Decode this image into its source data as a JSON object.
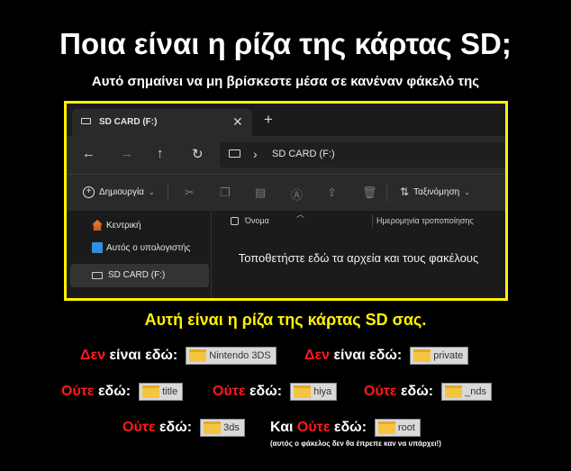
{
  "title": "Ποια είναι η ρίζα της κάρτας SD;",
  "subtitle": "Αυτό σημαίνει να μη βρίσκεστε μέσα σε κανέναν φάκελό της",
  "explorer": {
    "tab_label": "SD CARD (F:)",
    "tab_close": "✕",
    "new_tab": "+",
    "address_path": "SD CARD (F:)",
    "new_label": "Δημιουργία",
    "sort_label": "Ταξινόμηση",
    "sidebar": {
      "home": "Κεντρική",
      "this_pc": "Αυτός ο υπολογιστής",
      "sd_card": "SD CARD (F:)"
    },
    "columns": {
      "name": "Όνομα",
      "date": "Ημερομηνία τροποποίησης"
    },
    "placeholder": "Τοποθετήστε εδώ τα αρχεία και τους φακέλους"
  },
  "root_line": "Αυτή είναι η ρίζα της κάρτας SD σας.",
  "labels": {
    "den": "Δεν",
    "einai_edo": "είναι εδώ:",
    "oute": "Ούτε",
    "edo": "εδώ:",
    "kai": "Και",
    "note": "(αυτός ο φάκελος δεν θα έπρεπε καν να υπάρχει!)"
  },
  "folders": {
    "nintendo": "Nintendo 3DS",
    "private": "private",
    "title": "title",
    "hiya": "hiya",
    "nds": "_nds",
    "threeds": "3ds",
    "root": "root"
  },
  "colors": {
    "frame": "#fff200",
    "warning": "#ff1a1a",
    "root_line": "#fff200"
  }
}
